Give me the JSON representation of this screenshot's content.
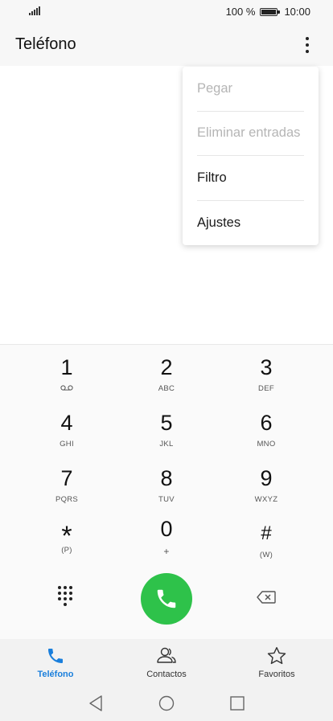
{
  "status_bar": {
    "battery_text": "100 %",
    "time": "10:00",
    "signal_icon": "signal-bars-icon",
    "battery_icon": "battery-full-icon"
  },
  "app_bar": {
    "title": "Teléfono",
    "more_icon": "more-vertical-icon"
  },
  "menu": {
    "items": [
      {
        "label": "Pegar",
        "enabled": false
      },
      {
        "label": "Eliminar entradas",
        "enabled": false
      },
      {
        "label": "Filtro",
        "enabled": true
      },
      {
        "label": "Ajustes",
        "enabled": true
      }
    ]
  },
  "dialpad": {
    "keys": [
      {
        "digit": "1",
        "letters": "",
        "sub_icon": "voicemail-icon"
      },
      {
        "digit": "2",
        "letters": "ABC"
      },
      {
        "digit": "3",
        "letters": "DEF"
      },
      {
        "digit": "4",
        "letters": "GHI"
      },
      {
        "digit": "5",
        "letters": "JKL"
      },
      {
        "digit": "6",
        "letters": "MNO"
      },
      {
        "digit": "7",
        "letters": "PQRS"
      },
      {
        "digit": "8",
        "letters": "TUV"
      },
      {
        "digit": "9",
        "letters": "WXYZ"
      },
      {
        "digit": "*",
        "letters": "(P)"
      },
      {
        "digit": "0",
        "letters": "+"
      },
      {
        "digit": "#",
        "letters": "(W)"
      }
    ],
    "call_color": "#2ec24a",
    "icons": [
      "dialpad-icon",
      "phone-call-icon",
      "backspace-icon"
    ]
  },
  "bottom_nav": {
    "items": [
      {
        "label": "Teléfono",
        "icon": "phone-icon",
        "active": true
      },
      {
        "label": "Contactos",
        "icon": "contacts-icon",
        "active": false
      },
      {
        "label": "Favoritos",
        "icon": "star-icon",
        "active": false
      }
    ],
    "active_color": "#1a7fdc"
  },
  "system_nav": {
    "icons": [
      "back-icon",
      "home-icon",
      "recents-icon"
    ]
  }
}
